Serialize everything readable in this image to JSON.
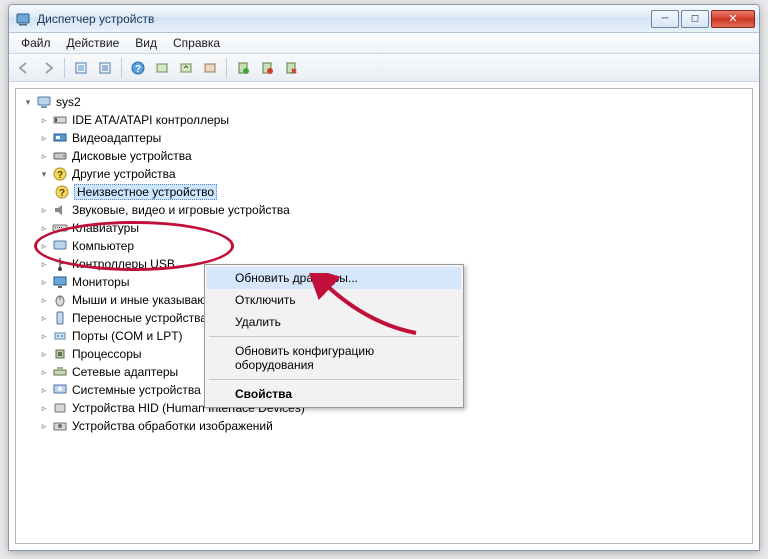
{
  "window": {
    "title": "Диспетчер устройств"
  },
  "menu": {
    "file": "Файл",
    "action": "Действие",
    "view": "Вид",
    "help": "Справка"
  },
  "tree": {
    "root": "sys2",
    "items": [
      "IDE ATA/ATAPI контроллеры",
      "Видеоадаптеры",
      "Дисковые устройства",
      "Другие устройства",
      "Звуковые, видео и игровые устройства",
      "Клавиатуры",
      "Компьютер",
      "Контроллеры USB",
      "Мониторы",
      "Мыши и иные указывающие устройства",
      "Переносные устройства",
      "Порты (COM и LPT)",
      "Процессоры",
      "Сетевые адаптеры",
      "Системные устройства",
      "Устройства HID (Human Interface Devices)",
      "Устройства обработки изображений"
    ],
    "unknown": "Неизвестное устройство"
  },
  "context": {
    "update": "Обновить драйверы...",
    "disable": "Отключить",
    "remove": "Удалить",
    "rescan": "Обновить конфигурацию оборудования",
    "props": "Свойства"
  }
}
